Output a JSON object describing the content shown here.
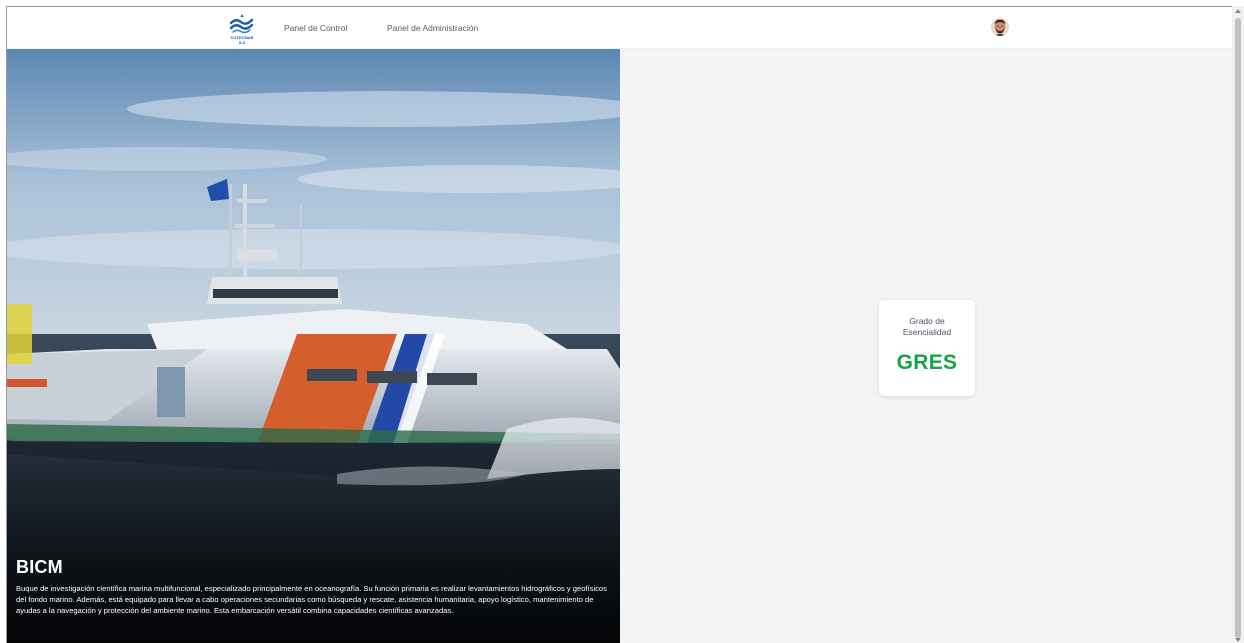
{
  "brand": {
    "logo_text": "COTECMAR",
    "logo_sub": "S.S"
  },
  "nav": {
    "links": [
      {
        "label": "Panel de Control"
      },
      {
        "label": "Panel de Administración"
      }
    ]
  },
  "hero": {
    "title": "BICM",
    "description": "Buque de investigación científica marina multifuncional, especializado principalmente en oceanografía. Su función primaria es realizar levantamientos hidrográficos y geofísicos del fondo marino. Además, está equipado para llevar a cabo operaciones secundarias como búsqueda y rescate, asistencia humanitaria, apoyo logístico, mantenimiento de ayudas a la navegación y protección del ambiente marino. Esta embarcación versátil combina capacidades científicas avanzadas."
  },
  "card": {
    "label_line1": "Grado de",
    "label_line2": "Esencialidad",
    "value": "GRES"
  },
  "colors": {
    "accent_green": "#16a34a",
    "brand_blue": "#1a5ca8",
    "panel_bg": "#f3f4f6"
  },
  "icons": {
    "logo": "cotecmar-wave-logo",
    "avatar": "user-avatar"
  }
}
